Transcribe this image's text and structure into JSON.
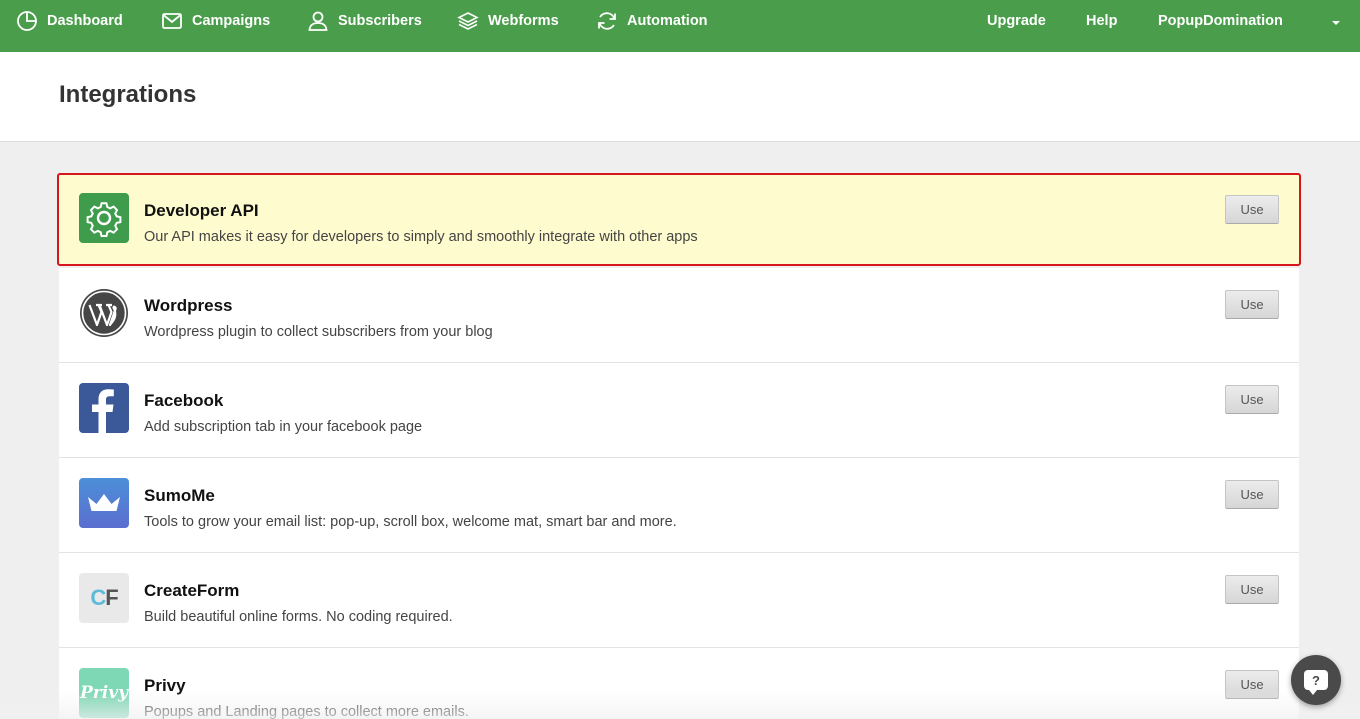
{
  "nav": {
    "items": [
      {
        "label": "Dashboard",
        "icon": "dashboard-icon"
      },
      {
        "label": "Campaigns",
        "icon": "envelope-icon"
      },
      {
        "label": "Subscribers",
        "icon": "user-icon"
      },
      {
        "label": "Webforms",
        "icon": "layers-icon"
      },
      {
        "label": "Automation",
        "icon": "refresh-icon"
      }
    ],
    "upgrade": "Upgrade",
    "help": "Help",
    "account": "PopupDomination"
  },
  "page": {
    "title": "Integrations"
  },
  "integrations": [
    {
      "title": "Developer API",
      "description": "Our API makes it easy for developers to simply and smoothly integrate with other apps",
      "button": "Use",
      "icon": "gear-icon",
      "highlighted": true
    },
    {
      "title": "Wordpress",
      "description": "Wordpress plugin to collect subscribers from your blog",
      "button": "Use",
      "icon": "wordpress-icon"
    },
    {
      "title": "Facebook",
      "description": "Add subscription tab in your facebook page",
      "button": "Use",
      "icon": "facebook-icon"
    },
    {
      "title": "SumoMe",
      "description": "Tools to grow your email list: pop-up, scroll box, welcome mat, smart bar and more.",
      "button": "Use",
      "icon": "crown-icon"
    },
    {
      "title": "CreateForm",
      "description": "Build beautiful online forms. No coding required.",
      "button": "Use",
      "icon": "createform-logo",
      "logo_text_c": "C",
      "logo_text_f": "F"
    },
    {
      "title": "Privy",
      "description": "Popups and Landing pages to collect more emails.",
      "button": "Use",
      "icon": "privy-logo",
      "logo_text": "Privy"
    }
  ],
  "help_bubble": {
    "label": "?"
  },
  "colors": {
    "brand_green": "#4a9e4b",
    "highlight_bg": "#fefccf",
    "highlight_border": "#d8141c"
  }
}
